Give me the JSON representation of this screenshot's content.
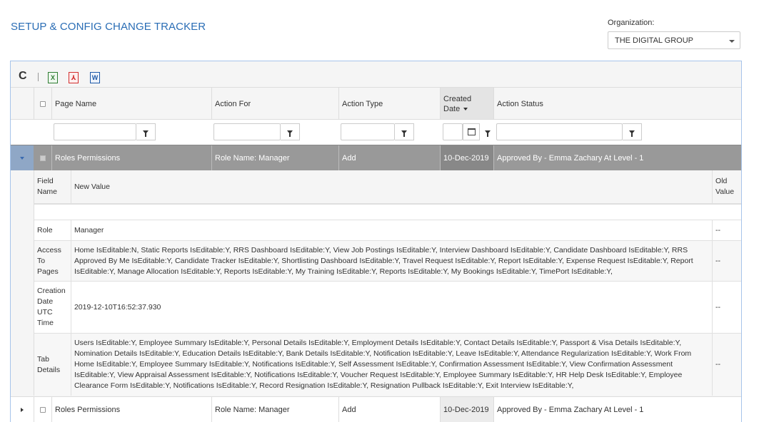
{
  "page": {
    "title": "SETUP & CONFIG CHANGE TRACKER"
  },
  "organization": {
    "label": "Organization:",
    "selected": "THE DIGITAL GROUP"
  },
  "toolbar": {
    "refresh_glyph": "C",
    "excel_glyph": "X",
    "pdf_glyph": "⅄",
    "word_glyph": "W"
  },
  "columns": {
    "page_name": "Page Name",
    "action_for": "Action For",
    "action_type": "Action Type",
    "created_date_line1": "Created",
    "created_date_line2": "Date",
    "action_status": "Action Status"
  },
  "group_row": {
    "page_name": "Roles Permissions",
    "action_for": "Role Name: Manager",
    "action_type": "Add",
    "created_date": "10-Dec-2019",
    "action_status": "Approved By - Emma Zachary At Level - 1"
  },
  "detail": {
    "headers": {
      "field_name_1": "Field",
      "field_name_2": "Name",
      "new_value": "New Value",
      "old_value_1": "Old",
      "old_value_2": "Value"
    },
    "rows": [
      {
        "field": "Role",
        "new_value": "Manager",
        "old_value": "--"
      },
      {
        "field": "Access To Pages",
        "new_value": "Home IsEditable:N, Static Reports IsEditable:Y, RRS Dashboard IsEditable:Y, View Job Postings IsEditable:Y, Interview Dashboard IsEditable:Y, Candidate Dashboard IsEditable:Y, RRS Approved By Me IsEditable:Y, Candidate Tracker IsEditable:Y, Shortlisting Dashboard IsEditable:Y, Travel Request IsEditable:Y, Report IsEditable:Y, Expense Request IsEditable:Y, Report IsEditable:Y, Manage Allocation IsEditable:Y, Reports IsEditable:Y, My Training IsEditable:Y, Reports IsEditable:Y, My Bookings IsEditable:Y, TimePort IsEditable:Y,",
        "old_value": "--"
      },
      {
        "field": "Creation Date UTC Time",
        "new_value": "2019-12-10T16:52:37.930",
        "old_value": "--"
      },
      {
        "field": "Tab Details",
        "new_value": "Users IsEditable:Y, Employee Summary IsEditable:Y, Personal Details IsEditable:Y, Employment Details IsEditable:Y, Contact Details IsEditable:Y, Passport & Visa Details IsEditable:Y, Nomination Details IsEditable:Y, Education Details IsEditable:Y, Bank Details IsEditable:Y, Notification IsEditable:Y, Leave IsEditable:Y, Attendance Regularization IsEditable:Y, Work From Home IsEditable:Y, Employee Summary IsEditable:Y, Notifications IsEditable:Y, Self Assessment IsEditable:Y, Confirmation Assessment IsEditable:Y, View Confirmation Assessment IsEditable:Y, View Appraisal Assessment IsEditable:Y, Notifications IsEditable:Y, Voucher Request IsEditable:Y, Employee Summary IsEditable:Y, HR Help Desk IsEditable:Y, Employee Clearance Form IsEditable:Y, Notifications IsEditable:Y, Record Resignation IsEditable:Y, Resignation Pullback IsEditable:Y, Exit Interview IsEditable:Y,",
        "old_value": "--"
      }
    ]
  },
  "row2": {
    "page_name": "Roles Permissions",
    "action_for": "Role Name: Manager",
    "action_type": "Add",
    "created_date": "10-Dec-2019",
    "action_status": "Approved By - Emma Zachary At Level - 1"
  }
}
